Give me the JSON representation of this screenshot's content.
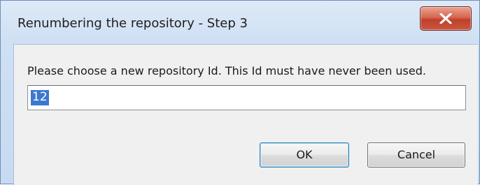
{
  "window": {
    "title": "Renumbering the repository - Step 3",
    "close_icon": "close-icon"
  },
  "dialog": {
    "prompt": "Please choose a new repository Id. This Id must have never been used.",
    "id_value": "12",
    "ok_label": "OK",
    "cancel_label": "Cancel"
  },
  "colors": {
    "selection": "#3b78d1",
    "close_button": "#c9563e",
    "titlebar": "#cfe0f4"
  }
}
